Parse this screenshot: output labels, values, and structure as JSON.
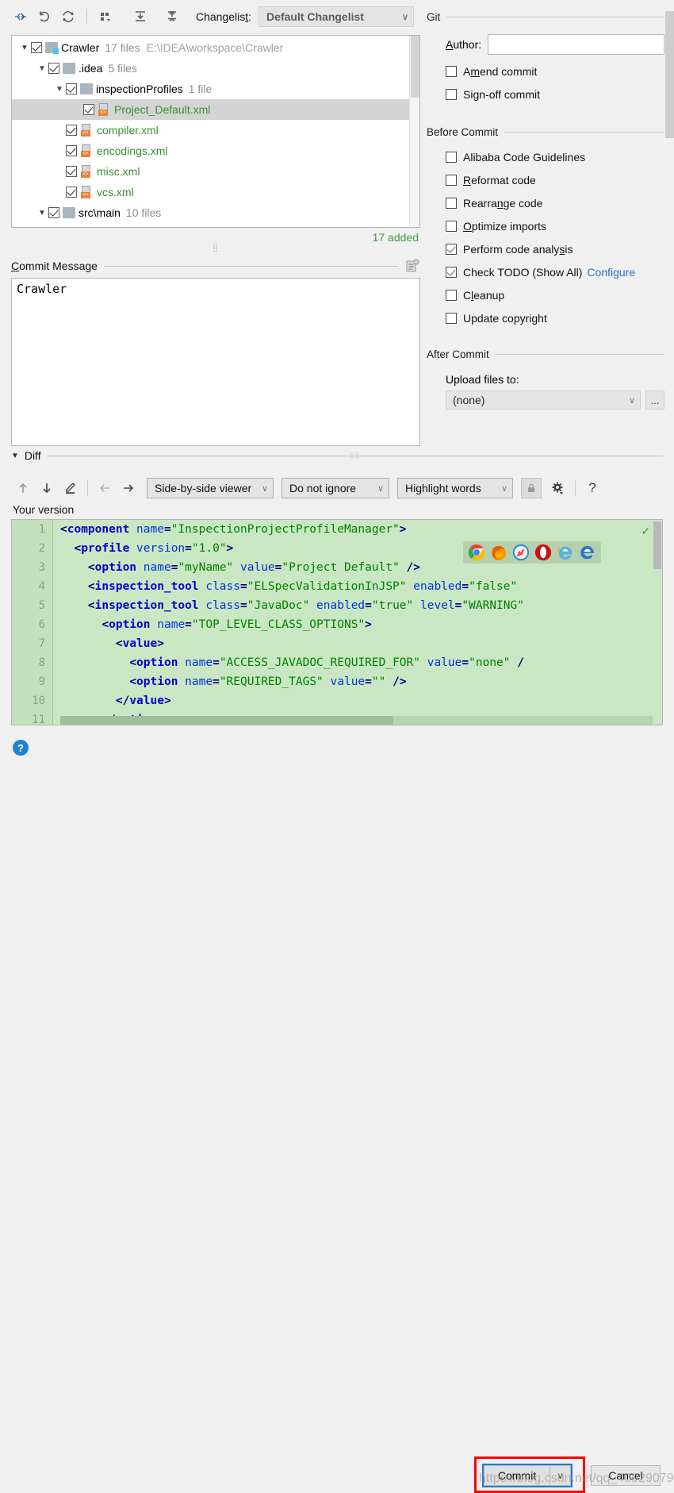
{
  "toolbar": {
    "icons": [
      {
        "name": "collapse-all-icon",
        "glyph": "⇥"
      },
      {
        "name": "revert-icon",
        "glyph": "↺"
      },
      {
        "name": "refresh-icon",
        "glyph": "⟳"
      },
      {
        "name": "group-by-icon",
        "glyph": "▦"
      },
      {
        "name": "expand-all-icon",
        "glyph": "⤓"
      },
      {
        "name": "collapse-icon",
        "glyph": "⤒"
      }
    ],
    "changelist_label": "Changelis",
    "changelist_label_underline": "t",
    "changelist_label_suffix": ":",
    "changelist_value": "Default Changelist"
  },
  "tree": {
    "rows": [
      {
        "indent": 0,
        "twisty": "v",
        "checked": true,
        "icon": "folder-module-icon",
        "name": "Crawler",
        "meta": "17 files",
        "path": "E:\\IDEA\\workspace\\Crawler",
        "selected": false,
        "type": "folder"
      },
      {
        "indent": 1,
        "twisty": "v",
        "checked": true,
        "icon": "folder-icon",
        "name": ".idea",
        "meta": "5 files",
        "path": "",
        "selected": false,
        "type": "folder"
      },
      {
        "indent": 2,
        "twisty": "v",
        "checked": true,
        "icon": "folder-icon",
        "name": "inspectionProfiles",
        "meta": "1 file",
        "path": "",
        "selected": false,
        "type": "folder"
      },
      {
        "indent": 3,
        "twisty": "",
        "checked": true,
        "icon": "xml-file-icon",
        "name": "Project_Default.xml",
        "meta": "",
        "path": "",
        "selected": true,
        "type": "file"
      },
      {
        "indent": 2,
        "twisty": "",
        "checked": true,
        "icon": "xml-file-icon",
        "name": "compiler.xml",
        "meta": "",
        "path": "",
        "selected": false,
        "type": "file"
      },
      {
        "indent": 2,
        "twisty": "",
        "checked": true,
        "icon": "xml-file-icon",
        "name": "encodings.xml",
        "meta": "",
        "path": "",
        "selected": false,
        "type": "file"
      },
      {
        "indent": 2,
        "twisty": "",
        "checked": true,
        "icon": "xml-file-icon",
        "name": "misc.xml",
        "meta": "",
        "path": "",
        "selected": false,
        "type": "file"
      },
      {
        "indent": 2,
        "twisty": "",
        "checked": true,
        "icon": "xml-file-icon",
        "name": "vcs.xml",
        "meta": "",
        "path": "",
        "selected": false,
        "type": "file"
      },
      {
        "indent": 1,
        "twisty": "v",
        "checked": true,
        "icon": "folder-icon",
        "name": "src\\main",
        "meta": "10 files",
        "path": "",
        "selected": false,
        "type": "folder"
      }
    ],
    "added_count": "17 added"
  },
  "commit_message": {
    "label_underline": "C",
    "label": "ommit Message",
    "value": "Crawler"
  },
  "git_group": {
    "title": "Git",
    "author_label_underline": "A",
    "author_label": "uthor:",
    "author_value": "",
    "options": [
      {
        "label_pre": "A",
        "label_u": "m",
        "label_post": "end commit",
        "checked": false,
        "name": "amend-commit"
      },
      {
        "label_pre": "Si",
        "label_u": "g",
        "label_post": "n-off commit",
        "checked": false,
        "name": "sign-off-commit"
      }
    ]
  },
  "before_commit": {
    "title": "Before Commit",
    "options": [
      {
        "label_pre": "Alibaba Code Guidelines",
        "label_u": "",
        "label_post": "",
        "checked": false,
        "name": "alibaba-code-guidelines"
      },
      {
        "label_pre": "",
        "label_u": "R",
        "label_post": "eformat code",
        "checked": false,
        "name": "reformat-code"
      },
      {
        "label_pre": "Rearra",
        "label_u": "n",
        "label_post": "ge code",
        "checked": false,
        "name": "rearrange-code"
      },
      {
        "label_pre": "",
        "label_u": "O",
        "label_post": "ptimize imports",
        "checked": false,
        "name": "optimize-imports"
      },
      {
        "label_pre": "Perform code analy",
        "label_u": "s",
        "label_post": "is",
        "checked": true,
        "name": "perform-code-analysis"
      },
      {
        "label_pre": "Check TODO (Show All)",
        "label_u": "",
        "label_post": "",
        "checked": true,
        "name": "check-todo",
        "link": "Configure"
      },
      {
        "label_pre": "C",
        "label_u": "l",
        "label_post": "eanup",
        "checked": false,
        "name": "cleanup"
      },
      {
        "label_pre": "Update copyright",
        "label_u": "",
        "label_post": "",
        "checked": false,
        "name": "update-copyright"
      }
    ]
  },
  "after_commit": {
    "title": "After Commit",
    "upload_label": "Upload files to:",
    "upload_value": "(none)",
    "dots_label": "..."
  },
  "diff": {
    "title": "Diff",
    "toolbar_icons": [
      {
        "name": "previous-difference-icon",
        "glyph": "↑"
      },
      {
        "name": "next-difference-icon",
        "glyph": "↓"
      },
      {
        "name": "edit-icon",
        "glyph": "✎"
      },
      {
        "name": "accept-left-icon",
        "glyph": "←"
      },
      {
        "name": "accept-right-icon",
        "glyph": "→"
      }
    ],
    "viewer_mode": "Side-by-side viewer",
    "ignore_mode": "Do not ignore",
    "highlight_mode": "Highlight words",
    "lock_icon": "lock-icon",
    "settings_icon": "gear-icon",
    "help_icon": "help-icon",
    "your_version_label": "Your version",
    "browsers": [
      {
        "name": "chrome-icon",
        "color": "#4285f4"
      },
      {
        "name": "firefox-icon",
        "color": "#e66000"
      },
      {
        "name": "safari-icon",
        "color": "#1b88ca"
      },
      {
        "name": "opera-icon",
        "color": "#cc0f16"
      },
      {
        "name": "internet-explorer-icon",
        "color": "#57b0e3"
      },
      {
        "name": "edge-icon",
        "color": "#2d78c5"
      }
    ],
    "code_lines": [
      {
        "num": "1",
        "indent": 0,
        "tokens": [
          {
            "t": "br",
            "v": "<"
          },
          {
            "t": "tag",
            "v": "component"
          },
          {
            "t": "plain",
            "v": " "
          },
          {
            "t": "attr",
            "v": "name"
          },
          {
            "t": "br",
            "v": "="
          },
          {
            "t": "val",
            "v": "\"InspectionProjectProfileManager\""
          },
          {
            "t": "br",
            "v": ">"
          }
        ]
      },
      {
        "num": "2",
        "indent": 1,
        "tokens": [
          {
            "t": "br",
            "v": "<"
          },
          {
            "t": "tag",
            "v": "profile"
          },
          {
            "t": "plain",
            "v": " "
          },
          {
            "t": "attr",
            "v": "version"
          },
          {
            "t": "br",
            "v": "="
          },
          {
            "t": "val",
            "v": "\"1.0\""
          },
          {
            "t": "br",
            "v": ">"
          }
        ]
      },
      {
        "num": "3",
        "indent": 2,
        "tokens": [
          {
            "t": "br",
            "v": "<"
          },
          {
            "t": "tag",
            "v": "option"
          },
          {
            "t": "plain",
            "v": " "
          },
          {
            "t": "attr",
            "v": "name"
          },
          {
            "t": "br",
            "v": "="
          },
          {
            "t": "val",
            "v": "\"myName\""
          },
          {
            "t": "plain",
            "v": " "
          },
          {
            "t": "attr",
            "v": "value"
          },
          {
            "t": "br",
            "v": "="
          },
          {
            "t": "val",
            "v": "\"Project Default\""
          },
          {
            "t": "plain",
            "v": " "
          },
          {
            "t": "br",
            "v": "/>"
          }
        ]
      },
      {
        "num": "4",
        "indent": 2,
        "tokens": [
          {
            "t": "br",
            "v": "<"
          },
          {
            "t": "tag",
            "v": "inspection_tool"
          },
          {
            "t": "plain",
            "v": " "
          },
          {
            "t": "attr",
            "v": "class"
          },
          {
            "t": "br",
            "v": "="
          },
          {
            "t": "val",
            "v": "\"ELSpecValidationInJSP\""
          },
          {
            "t": "plain",
            "v": " "
          },
          {
            "t": "attr",
            "v": "enabled"
          },
          {
            "t": "br",
            "v": "="
          },
          {
            "t": "val",
            "v": "\"false\""
          }
        ]
      },
      {
        "num": "5",
        "indent": 2,
        "tokens": [
          {
            "t": "br",
            "v": "<"
          },
          {
            "t": "tag",
            "v": "inspection_tool"
          },
          {
            "t": "plain",
            "v": " "
          },
          {
            "t": "attr",
            "v": "class"
          },
          {
            "t": "br",
            "v": "="
          },
          {
            "t": "val",
            "v": "\"JavaDoc\""
          },
          {
            "t": "plain",
            "v": " "
          },
          {
            "t": "attr",
            "v": "enabled"
          },
          {
            "t": "br",
            "v": "="
          },
          {
            "t": "val",
            "v": "\"true\""
          },
          {
            "t": "plain",
            "v": " "
          },
          {
            "t": "attr",
            "v": "level"
          },
          {
            "t": "br",
            "v": "="
          },
          {
            "t": "val",
            "v": "\"WARNING\""
          }
        ]
      },
      {
        "num": "6",
        "indent": 3,
        "tokens": [
          {
            "t": "br",
            "v": "<"
          },
          {
            "t": "tag",
            "v": "option"
          },
          {
            "t": "plain",
            "v": " "
          },
          {
            "t": "attr",
            "v": "name"
          },
          {
            "t": "br",
            "v": "="
          },
          {
            "t": "val",
            "v": "\"TOP_LEVEL_CLASS_OPTIONS\""
          },
          {
            "t": "br",
            "v": ">"
          }
        ]
      },
      {
        "num": "7",
        "indent": 4,
        "tokens": [
          {
            "t": "br",
            "v": "<"
          },
          {
            "t": "tag",
            "v": "value"
          },
          {
            "t": "br",
            "v": ">"
          }
        ]
      },
      {
        "num": "8",
        "indent": 5,
        "tokens": [
          {
            "t": "br",
            "v": "<"
          },
          {
            "t": "tag",
            "v": "option"
          },
          {
            "t": "plain",
            "v": " "
          },
          {
            "t": "attr",
            "v": "name"
          },
          {
            "t": "br",
            "v": "="
          },
          {
            "t": "val",
            "v": "\"ACCESS_JAVADOC_REQUIRED_FOR\""
          },
          {
            "t": "plain",
            "v": " "
          },
          {
            "t": "attr",
            "v": "value"
          },
          {
            "t": "br",
            "v": "="
          },
          {
            "t": "val",
            "v": "\"none\""
          },
          {
            "t": "plain",
            "v": " "
          },
          {
            "t": "br",
            "v": "/"
          }
        ]
      },
      {
        "num": "9",
        "indent": 5,
        "tokens": [
          {
            "t": "br",
            "v": "<"
          },
          {
            "t": "tag",
            "v": "option"
          },
          {
            "t": "plain",
            "v": " "
          },
          {
            "t": "attr",
            "v": "name"
          },
          {
            "t": "br",
            "v": "="
          },
          {
            "t": "val",
            "v": "\"REQUIRED_TAGS\""
          },
          {
            "t": "plain",
            "v": " "
          },
          {
            "t": "attr",
            "v": "value"
          },
          {
            "t": "br",
            "v": "="
          },
          {
            "t": "val",
            "v": "\"\""
          },
          {
            "t": "plain",
            "v": " "
          },
          {
            "t": "br",
            "v": "/>"
          }
        ]
      },
      {
        "num": "10",
        "indent": 4,
        "tokens": [
          {
            "t": "br",
            "v": "</"
          },
          {
            "t": "tag",
            "v": "value"
          },
          {
            "t": "br",
            "v": ">"
          }
        ]
      },
      {
        "num": "11",
        "indent": 3,
        "tokens": [
          {
            "t": "br",
            "v": "</"
          },
          {
            "t": "tag",
            "v": "option"
          },
          {
            "t": "br",
            "v": ">"
          }
        ]
      }
    ]
  },
  "bottom": {
    "help_glyph": "?",
    "commit_label": "Commit",
    "commit_dropdown_glyph": "∨",
    "cancel_label": "Cancel",
    "watermark": "https://blog.csdn.net/qq_40929079"
  },
  "colors": {
    "window_bg": "#f0f0f0",
    "diff_added_bg": "#c9e7c2",
    "added_text": "#3f9b3f",
    "link": "#2a6fc9",
    "file_green": "#36912f",
    "highlight_red": "#ff0000",
    "focus_blue": "#1a7ed6"
  }
}
